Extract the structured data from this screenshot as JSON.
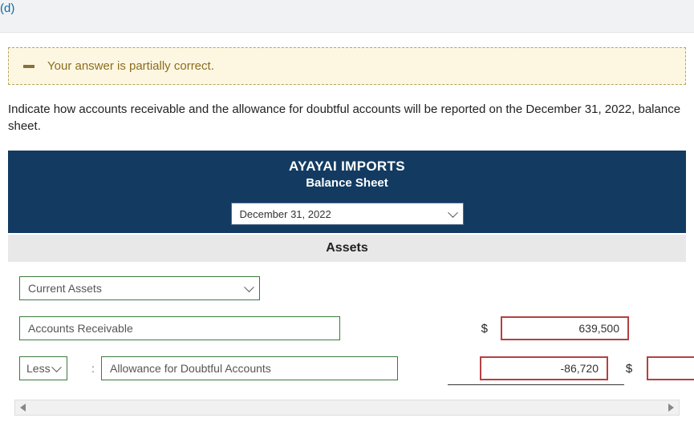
{
  "topbar": {
    "part_label": "(d)"
  },
  "feedback": {
    "text": "Your answer is partially correct."
  },
  "prompt": {
    "text": "Indicate how accounts receivable and the allowance for doubtful accounts will be reported on the December 31, 2022, balance sheet."
  },
  "sheet": {
    "company": "AYAYAI IMPORTS",
    "title": "Balance Sheet",
    "date_selected": "December 31, 2022",
    "section": "Assets",
    "rows": {
      "category_select": "Current Assets",
      "line1_label": "Accounts Receivable",
      "line1_currency": "$",
      "line1_value": "639,500",
      "less_label": "Less",
      "colon": ":",
      "line2_label": "Allowance for Doubtful Accounts",
      "line2_value": "-86,720",
      "line2_currency": "$",
      "line2_result": ""
    }
  }
}
